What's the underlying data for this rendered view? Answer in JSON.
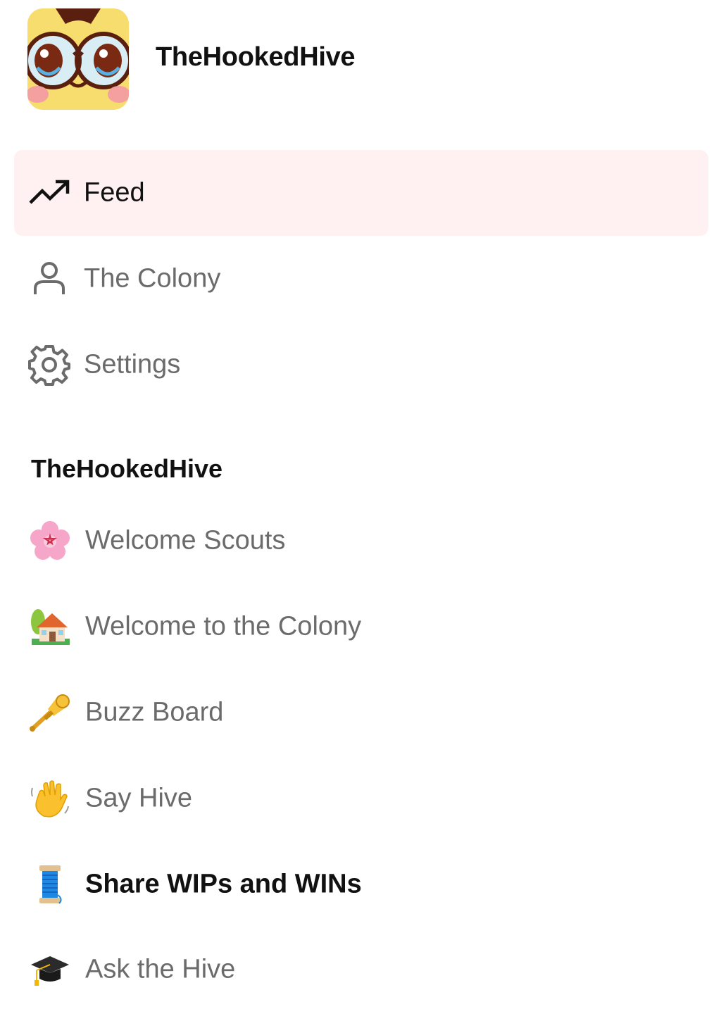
{
  "app": {
    "title": "TheHookedHive",
    "logo_icon": "owl-mascot-icon"
  },
  "nav": {
    "items": [
      {
        "label": "Feed",
        "icon": "trending-up-icon",
        "active": true
      },
      {
        "label": "The Colony",
        "icon": "person-icon",
        "active": false
      },
      {
        "label": "Settings",
        "icon": "gear-icon",
        "active": false
      }
    ]
  },
  "community": {
    "title": "TheHookedHive",
    "channels": [
      {
        "label": "Welcome Scouts",
        "icon": "cherry-blossom-icon",
        "unread": false
      },
      {
        "label": "Welcome to the Colony",
        "icon": "house-with-garden-icon",
        "unread": false
      },
      {
        "label": "Buzz Board",
        "icon": "trumpet-icon",
        "unread": false
      },
      {
        "label": "Say Hive",
        "icon": "waving-hand-icon",
        "unread": false
      },
      {
        "label": "Share WIPs and WINs",
        "icon": "spool-of-thread-icon",
        "unread": true
      },
      {
        "label": "Ask the Hive",
        "icon": "graduation-cap-icon",
        "unread": false
      }
    ]
  },
  "colors": {
    "active_bg": "#fff0f1",
    "text_primary": "#111111",
    "text_muted": "#6b6b6b"
  }
}
